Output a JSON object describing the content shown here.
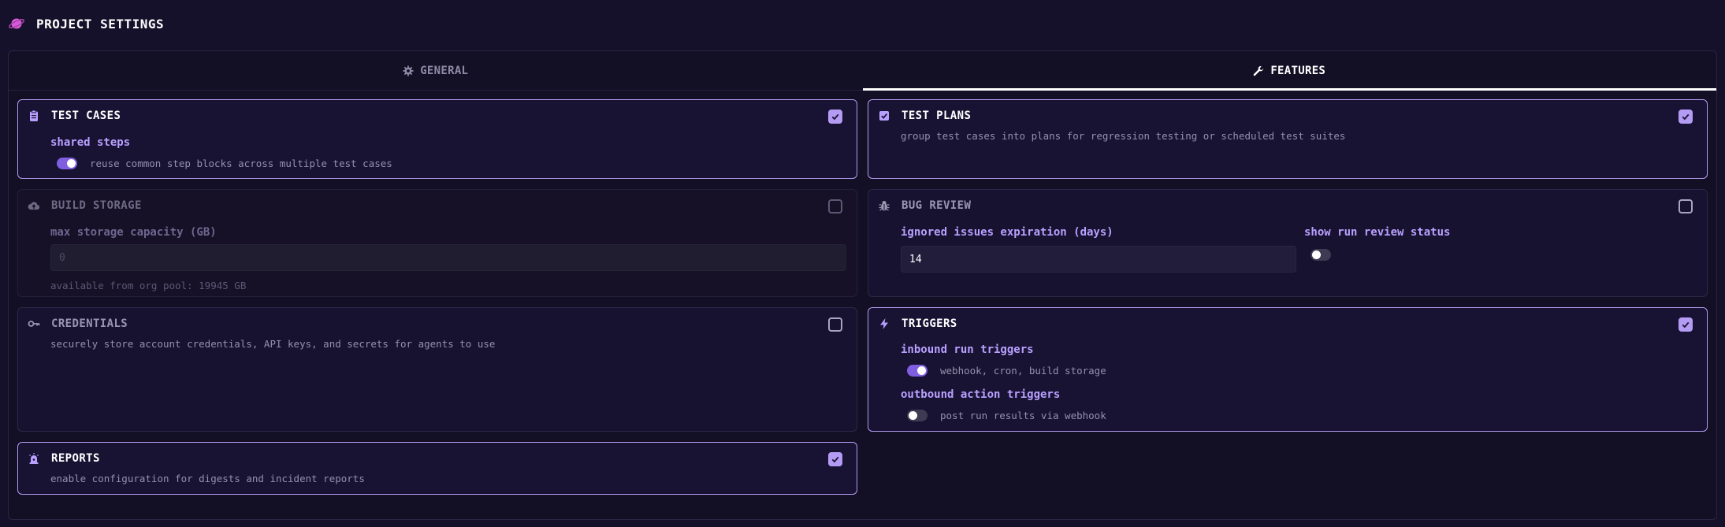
{
  "header": {
    "title": "PROJECT SETTINGS",
    "icon": "planet-icon",
    "accent": "#d65ad8"
  },
  "tabs": [
    {
      "label": "GENERAL",
      "icon": "gear-icon",
      "active": false
    },
    {
      "label": "FEATURES",
      "icon": "wrench-icon",
      "active": true
    }
  ],
  "cards": {
    "test_cases": {
      "title": "TEST CASES",
      "icon": "clipboard-icon",
      "checked": true,
      "option_label": "shared steps",
      "toggle_on": true,
      "toggle_desc": "reuse common step blocks across multiple test cases"
    },
    "test_plans": {
      "title": "TEST PLANS",
      "icon": "checkbox-icon",
      "checked": true,
      "desc": "group test cases into plans for regression testing or scheduled test suites"
    },
    "build_storage": {
      "title": "BUILD STORAGE",
      "icon": "cloud-upload-icon",
      "checked": false,
      "field_label": "max storage capacity (GB)",
      "field_placeholder": "0",
      "hint": "available from org pool: 19945 GB"
    },
    "bug_review": {
      "title": "BUG REVIEW",
      "icon": "bug-icon",
      "checked": false,
      "field_label": "ignored issues expiration (days)",
      "field_value": "14",
      "toggle_label": "show run review status",
      "toggle_on": false
    },
    "credentials": {
      "title": "CREDENTIALS",
      "icon": "key-icon",
      "checked": false,
      "desc": "securely store account credentials, API keys, and secrets for agents to use"
    },
    "triggers": {
      "title": "TRIGGERS",
      "icon": "lightning-icon",
      "checked": true,
      "inbound_label": "inbound run triggers",
      "inbound_on": true,
      "inbound_desc": "webhook, cron, build storage",
      "outbound_label": "outbound action triggers",
      "outbound_on": false,
      "outbound_desc": "post run results via webhook"
    },
    "reports": {
      "title": "REPORTS",
      "icon": "alarm-icon",
      "checked": true,
      "desc": "enable configuration for digests and incident reports"
    }
  }
}
